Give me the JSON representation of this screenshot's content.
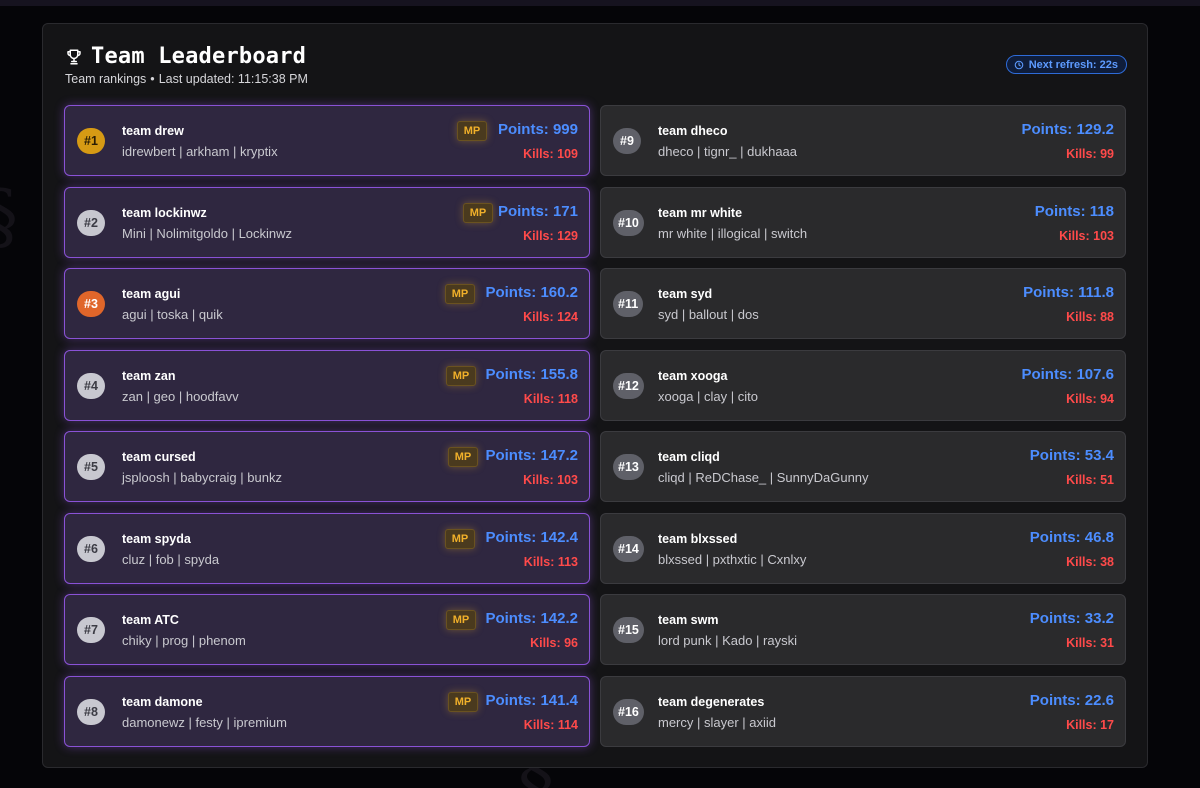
{
  "header": {
    "title": "Team Leaderboard",
    "subtitle_prefix": "Team rankings",
    "separator": "•",
    "last_updated": "Last updated: 11:15:38 PM",
    "refresh_label": "Next refresh: 22s"
  },
  "colors": {
    "points": "#4c8dff",
    "kills": "#ff4a4a",
    "top_border": "#8a52d6",
    "mp_badge": "#f0b02a"
  },
  "teams": [
    {
      "rank": "#1",
      "name": "team drew",
      "players": "idrewbert | arkham | kryptix",
      "mp": "MP",
      "points": "Points: 999",
      "kills": "Kills: 109"
    },
    {
      "rank": "#2",
      "name": "team lockinwz",
      "players": "Mini | Nolimitgoldo | Lockinwz",
      "mp": "MP",
      "points": "Points: 171",
      "kills": "Kills: 129"
    },
    {
      "rank": "#3",
      "name": "team agui",
      "players": "agui | toska | quik",
      "mp": "MP",
      "points": "Points: 160.2",
      "kills": "Kills: 124"
    },
    {
      "rank": "#4",
      "name": "team zan",
      "players": "zan | geo | hoodfavv",
      "mp": "MP",
      "points": "Points: 155.8",
      "kills": "Kills: 118"
    },
    {
      "rank": "#5",
      "name": "team cursed",
      "players": "jsploosh | babycraig | bunkz",
      "mp": "MP",
      "points": "Points: 147.2",
      "kills": "Kills: 103"
    },
    {
      "rank": "#6",
      "name": "team spyda",
      "players": "cluz | fob | spyda",
      "mp": "MP",
      "points": "Points: 142.4",
      "kills": "Kills: 113"
    },
    {
      "rank": "#7",
      "name": "team ATC",
      "players": "chiky | prog | phenom",
      "mp": "MP",
      "points": "Points: 142.2",
      "kills": "Kills: 96"
    },
    {
      "rank": "#8",
      "name": "team damone",
      "players": "damonewz | festy | ipremium",
      "mp": "MP",
      "points": "Points: 141.4",
      "kills": "Kills: 114"
    },
    {
      "rank": "#9",
      "name": "team dheco",
      "players": "dheco | tignr_ | dukhaaa",
      "points": "Points: 129.2",
      "kills": "Kills: 99"
    },
    {
      "rank": "#10",
      "name": "team mr white",
      "players": "mr white | illogical | switch",
      "points": "Points: 118",
      "kills": "Kills: 103"
    },
    {
      "rank": "#11",
      "name": "team syd",
      "players": "syd | ballout | dos",
      "points": "Points: 111.8",
      "kills": "Kills: 88"
    },
    {
      "rank": "#12",
      "name": "team xooga",
      "players": "xooga | clay | cito",
      "points": "Points: 107.6",
      "kills": "Kills: 94"
    },
    {
      "rank": "#13",
      "name": "team cliqd",
      "players": "cliqd | ReDChase_ | SunnyDaGunny",
      "points": "Points: 53.4",
      "kills": "Kills: 51"
    },
    {
      "rank": "#14",
      "name": "team blxssed",
      "players": "blxssed | pxthxtic | Cxnlxy",
      "points": "Points: 46.8",
      "kills": "Kills: 38"
    },
    {
      "rank": "#15",
      "name": "team swm",
      "players": "lord punk | Kado | rayski",
      "points": "Points: 33.2",
      "kills": "Kills: 31"
    },
    {
      "rank": "#16",
      "name": "team degenerates",
      "players": "mercy | slayer | axiid",
      "points": "Points: 22.6",
      "kills": "Kills: 17"
    }
  ]
}
